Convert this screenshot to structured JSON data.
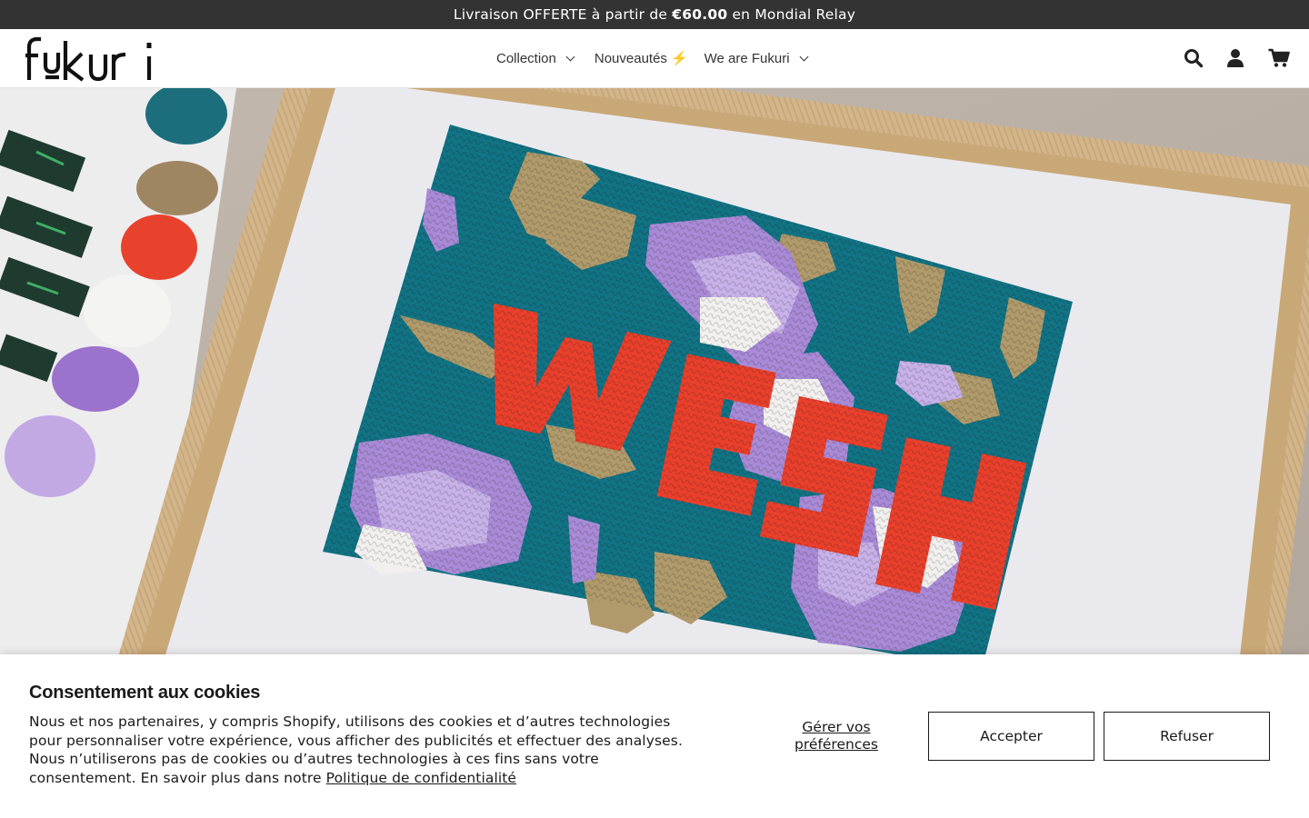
{
  "announcement": {
    "prefix": "Livraison OFFERTE à partir de ",
    "amount": "€60.00",
    "suffix": " en Mondial Relay"
  },
  "header": {
    "logo_text": "fukuri",
    "nav": [
      {
        "label": "Collection",
        "has_dropdown": true
      },
      {
        "label": "Nouveautés",
        "icon": "lightning-bolt-icon",
        "has_dropdown": false
      },
      {
        "label": "We are Fukuri",
        "has_dropdown": true
      }
    ],
    "icons": [
      "search-icon",
      "account-icon",
      "cart-icon"
    ]
  },
  "hero": {
    "embroidery_word": "WESH",
    "colors": {
      "canvas_teal": "#127384",
      "letter_red": "#e8402c",
      "lavender": "#a98ad6",
      "tan": "#b09a6b",
      "frame_oak": "#d3b58a",
      "mat": "#ebebef"
    }
  },
  "cookie": {
    "title": "Consentement aux cookies",
    "body_before_link": "Nous et nos partenaires, y compris Shopify, utilisons des cookies et d’autres technologies pour personnaliser votre expérience, vous afficher des publicités et effectuer des analyses. Nous n’utiliserons pas de cookies ou d’autres technologies à ces fins sans votre consentement. En savoir plus dans notre ",
    "link_text": "Politique de confidentialité",
    "manage_label": "Gérer vos préférences",
    "accept_label": "Accepter",
    "refuse_label": "Refuser"
  }
}
